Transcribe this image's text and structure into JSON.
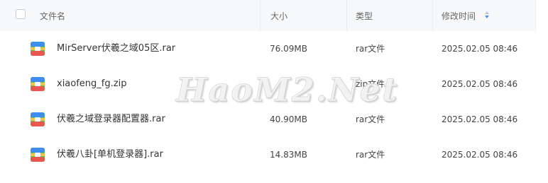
{
  "header": {
    "name_label": "文件名",
    "size_label": "大小",
    "type_label": "类型",
    "time_label": "修改时间"
  },
  "files": [
    {
      "name": "MirServer伏羲之域05区.rar",
      "size": "76.09MB",
      "type": "rar文件",
      "time": "2025.02.05 08:46",
      "icon": "archive-icon"
    },
    {
      "name": "xiaofeng_fg.zip",
      "size": "",
      "type": "zip文件",
      "time": "2025.02.05 08:46",
      "icon": "archive-icon"
    },
    {
      "name": "伏羲之域登录器配置器.rar",
      "size": "40.90MB",
      "type": "rar文件",
      "time": "2025.02.05 08:46",
      "icon": "archive-icon"
    },
    {
      "name": "伏羲八卦[单机登录器].rar",
      "size": "14.83MB",
      "type": "rar文件",
      "time": "2025.02.05 08:46",
      "icon": "archive-icon"
    }
  ],
  "watermark": "HaoM2.Net",
  "colors": {
    "header_bg": "#f7f8fa",
    "sort_active": "#4a8ff0",
    "icon_blue": "#3d8ef0",
    "icon_green": "#5cbf5a",
    "icon_yellow": "#f6c344",
    "icon_red": "#e8584f"
  }
}
